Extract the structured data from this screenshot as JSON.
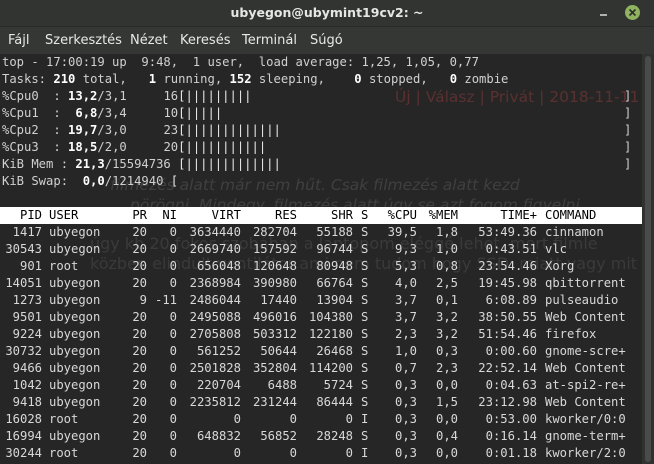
{
  "window": {
    "title": "ubyegon@ubymint19cv2: ~",
    "accent": "#8fb35f"
  },
  "menu": [
    "Fájl",
    "Szerkesztés",
    "Nézet",
    "Keresés",
    "Terminál",
    "Súgó"
  ],
  "top": {
    "line1": "top - 17:00:19 up  9:48,  1 user,  load average: 1,25, 1,05, 0,77",
    "tasks_label": "Tasks:",
    "tasks_total": "210",
    "tasks_total_label": "total,",
    "tasks_running": "1",
    "tasks_running_label": "running,",
    "tasks_sleeping": "152",
    "tasks_sleeping_label": "sleeping,",
    "tasks_stopped": "0",
    "tasks_stopped_label": "stopped,",
    "tasks_zombie": "0",
    "tasks_zombie_label": "zombie",
    "cpus": [
      {
        "label": "%Cpu0  : ",
        "main": "13,2",
        "rest": "/3,1",
        "num": "16",
        "bars": "[|||||||||",
        "fill": 0.16
      },
      {
        "label": "%Cpu1  : ",
        "main": " 6,8",
        "rest": "/3,4",
        "num": "10",
        "bars": "[|||||",
        "fill": 0.1
      },
      {
        "label": "%Cpu2  : ",
        "main": "19,7",
        "rest": "/3,0",
        "num": "23",
        "bars": "[|||||||||||||",
        "fill": 0.23
      },
      {
        "label": "%Cpu3  : ",
        "main": "18,5",
        "rest": "/2,0",
        "num": "20",
        "bars": "[|||||||||||",
        "fill": 0.2
      }
    ],
    "mem_label": "KiB Mem : ",
    "mem_main": "21,3",
    "mem_rest": "/15594736",
    "mem_bars": "[|||||||||||||",
    "swap_label": "KiB Swap: ",
    "swap_main": " 0,0",
    "swap_rest": "/1214940",
    "swap_bars": "[",
    "close_bracket": "]",
    "columns": [
      "PID",
      "USER",
      "PR",
      "NI",
      "VIRT",
      "RES",
      "SHR",
      "S",
      "%CPU",
      "%MEM",
      "TIME+",
      "COMMAND"
    ],
    "processes": [
      [
        "1417",
        "ubyegon",
        "20",
        "0",
        "3634440",
        "282704",
        "55188",
        "S",
        "39,5",
        "1,8",
        "53:49.36",
        "cinnamon"
      ],
      [
        "30543",
        "ubyegon",
        "20",
        "0",
        "2669740",
        "157592",
        "96744",
        "S",
        "9,3",
        "1,0",
        "0:43.51",
        "vlc"
      ],
      [
        "901",
        "root",
        "20",
        "0",
        "656048",
        "120648",
        "80948",
        "S",
        "5,3",
        "0,8",
        "23:54.46",
        "Xorg"
      ],
      [
        "14051",
        "ubyegon",
        "20",
        "0",
        "2368984",
        "390980",
        "66764",
        "S",
        "4,0",
        "2,5",
        "19:45.98",
        "qbittorrent"
      ],
      [
        "1273",
        "ubyegon",
        "9",
        "-11",
        "2486044",
        "17440",
        "13904",
        "S",
        "3,7",
        "0,1",
        "6:08.89",
        "pulseaudio"
      ],
      [
        "9501",
        "ubyegon",
        "20",
        "0",
        "2495088",
        "496016",
        "104380",
        "S",
        "3,7",
        "3,2",
        "38:50.55",
        "Web Content"
      ],
      [
        "9224",
        "ubyegon",
        "20",
        "0",
        "2705808",
        "503312",
        "122180",
        "S",
        "2,3",
        "3,2",
        "51:54.46",
        "firefox"
      ],
      [
        "30732",
        "ubyegon",
        "20",
        "0",
        "561252",
        "50644",
        "26468",
        "S",
        "1,0",
        "0,3",
        "0:00.60",
        "gnome-scre+"
      ],
      [
        "9466",
        "ubyegon",
        "20",
        "0",
        "2501828",
        "352804",
        "114200",
        "S",
        "0,7",
        "2,3",
        "22:52.14",
        "Web Content"
      ],
      [
        "1042",
        "ubyegon",
        "20",
        "0",
        "220704",
        "6488",
        "5724",
        "S",
        "0,3",
        "0,0",
        "0:04.63",
        "at-spi2-re+"
      ],
      [
        "9418",
        "ubyegon",
        "20",
        "0",
        "2235812",
        "231244",
        "86444",
        "S",
        "0,3",
        "1,5",
        "23:12.98",
        "Web Content"
      ],
      [
        "16028",
        "root",
        "20",
        "0",
        "0",
        "0",
        "0",
        "I",
        "0,3",
        "0,0",
        "0:53.00",
        "kworker/0:0"
      ],
      [
        "16994",
        "ubyegon",
        "20",
        "0",
        "648832",
        "56852",
        "28248",
        "S",
        "0,3",
        "0,4",
        "0:16.14",
        "gnome-term+"
      ],
      [
        "30244",
        "root",
        "20",
        "0",
        "0",
        "0",
        "0",
        "I",
        "0,3",
        "0,0",
        "0:01.18",
        "kworker/2:0"
      ]
    ]
  },
  "background_ghost": {
    "reply_links": "Új | Válasz | Privát | 2018-11-11",
    "line_a": "filmezés alatt már nem hűt. Csak filmezés alatt kezd",
    "line_b": "pörögni. Mindegy, filmezés alatt úgy se azt fogom figyelni.",
    "line_c": "úgy kb 20 fokos szobában a laptopom eléggé lehet. mert filmle",
    "line_d": "közben elindult ventilátor ami nem tudom hogy SSD. miatt vagy mit"
  }
}
